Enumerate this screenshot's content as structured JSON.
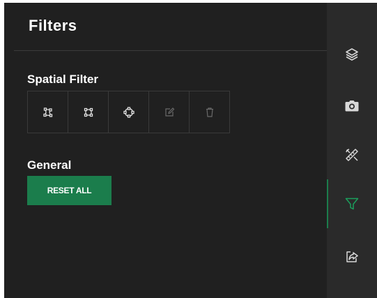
{
  "panel": {
    "title": "Filters",
    "spatial_filter": {
      "title": "Spatial Filter",
      "tools": [
        {
          "name": "draw-polygon-icon",
          "enabled": true
        },
        {
          "name": "draw-rectangle-icon",
          "enabled": true
        },
        {
          "name": "draw-circle-icon",
          "enabled": true
        },
        {
          "name": "edit-icon",
          "enabled": false
        },
        {
          "name": "delete-icon",
          "enabled": false
        }
      ]
    },
    "general": {
      "title": "General",
      "reset_label": "RESET ALL"
    }
  },
  "sidebar": {
    "items": [
      {
        "icon": "layers-icon",
        "active": false
      },
      {
        "icon": "camera-icon",
        "active": false
      },
      {
        "icon": "measure-tools-icon",
        "active": false
      },
      {
        "icon": "filter-icon",
        "active": true
      },
      {
        "icon": "share-icon",
        "active": false
      }
    ]
  },
  "colors": {
    "accent": "#1b7d4c",
    "panel_background": "#202020",
    "sidebar_background": "#2a2a2a",
    "icon_default": "#d8d8d8",
    "icon_disabled": "#6a6a6a"
  }
}
